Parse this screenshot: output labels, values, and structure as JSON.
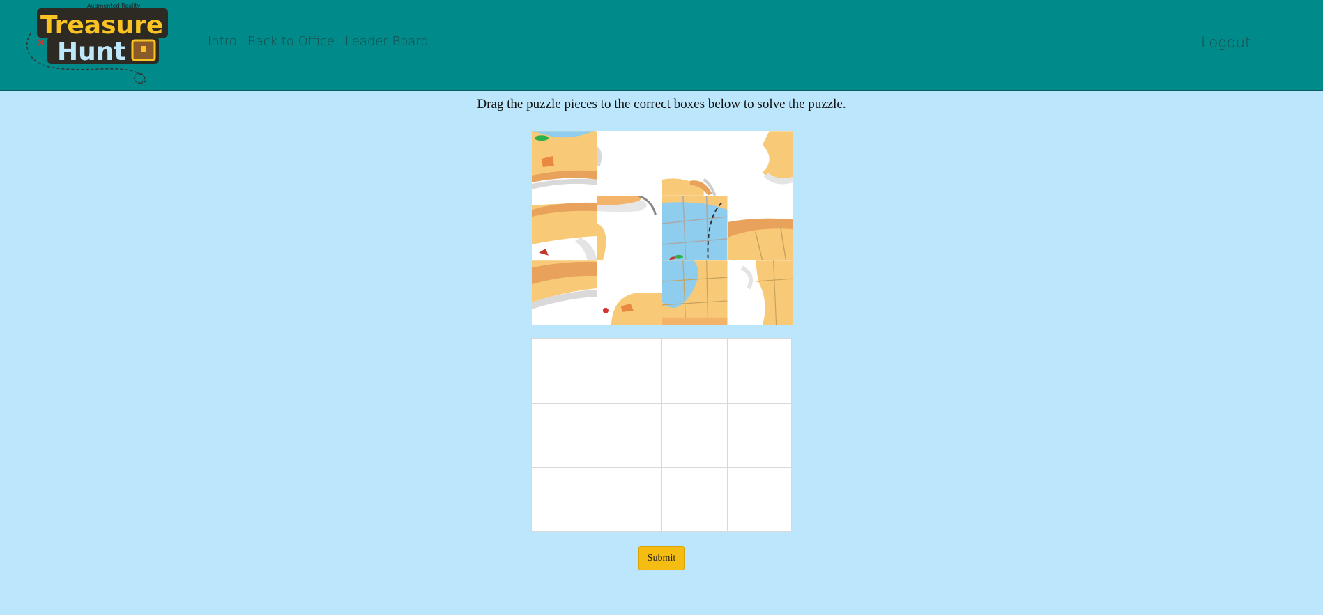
{
  "logo": {
    "small_text": "Augmented Reality",
    "line1": "Treasure",
    "line2": "Hunt"
  },
  "nav": {
    "items": [
      {
        "label": "Intro"
      },
      {
        "label": "Back to Office"
      },
      {
        "label": "Leader Board"
      }
    ],
    "logout": "Logout"
  },
  "instructions": "Drag the puzzle pieces to the correct boxes below to solve the puzzle.",
  "puzzle": {
    "rows": 3,
    "cols": 4,
    "pieces_count": 12,
    "slots_count": 12
  },
  "submit_label": "Submit",
  "colors": {
    "header": "#018a8a",
    "background": "#bbe6fb",
    "submit": "#f5bd12",
    "sand": "#f8c977",
    "sand_dark": "#e9a25b",
    "water": "#8fcdee"
  }
}
